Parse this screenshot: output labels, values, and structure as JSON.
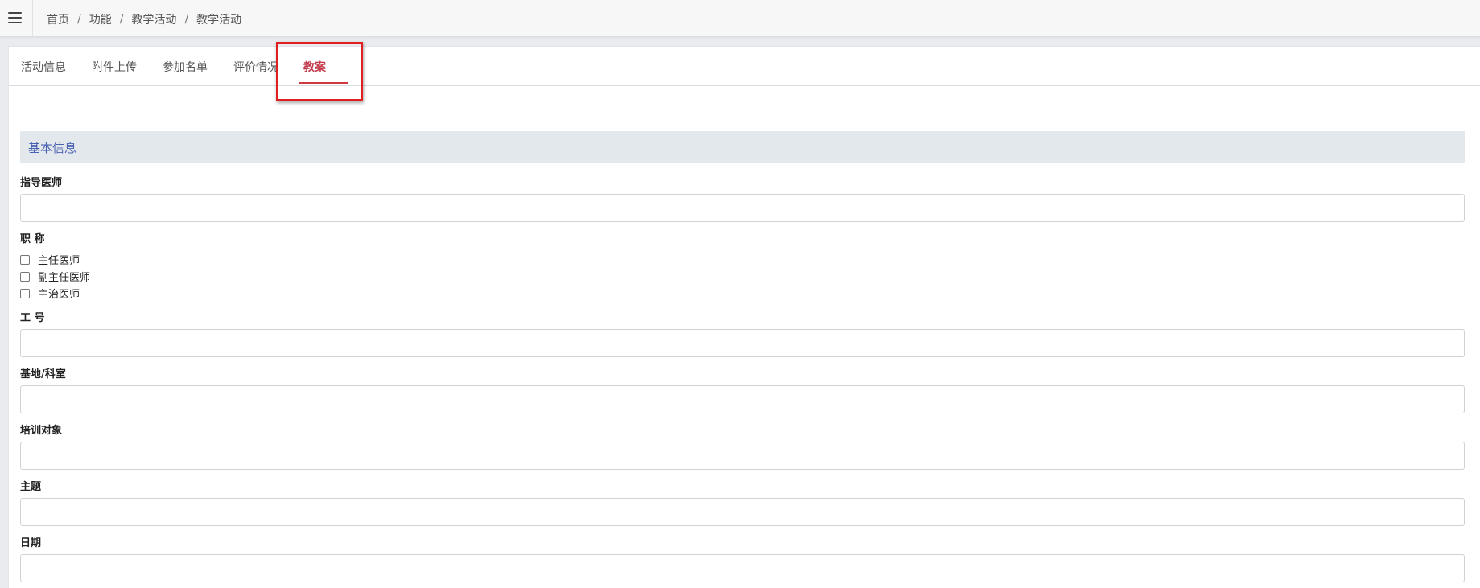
{
  "breadcrumb": {
    "items": [
      "首页",
      "功能",
      "教学活动",
      "教学活动"
    ],
    "separator": "/"
  },
  "tabs": [
    {
      "label": "活动信息",
      "active": false
    },
    {
      "label": "附件上传",
      "active": false
    },
    {
      "label": "参加名单",
      "active": false
    },
    {
      "label": "评价情况",
      "active": false
    },
    {
      "label": "教案",
      "active": true
    }
  ],
  "section": {
    "title": "基本信息"
  },
  "fields": {
    "instructor": {
      "label": "指导医师",
      "value": ""
    },
    "title": {
      "label": "职 称",
      "options": [
        {
          "label": "主任医师",
          "checked": false
        },
        {
          "label": "副主任医师",
          "checked": false
        },
        {
          "label": "主治医师",
          "checked": false
        }
      ]
    },
    "employee_id": {
      "label": "工 号",
      "value": ""
    },
    "department": {
      "label": "基地/科室",
      "value": ""
    },
    "trainees": {
      "label": "培训对象",
      "value": ""
    },
    "topic": {
      "label": "主题",
      "value": ""
    },
    "date": {
      "label": "日期",
      "value": ""
    }
  },
  "colors": {
    "active_tab": "#c23a4b",
    "highlight_box": "#e02020",
    "section_title": "#4a62b2",
    "section_bg": "#e3e8ec"
  },
  "icons": {
    "menu": "hamburger-menu-icon"
  }
}
